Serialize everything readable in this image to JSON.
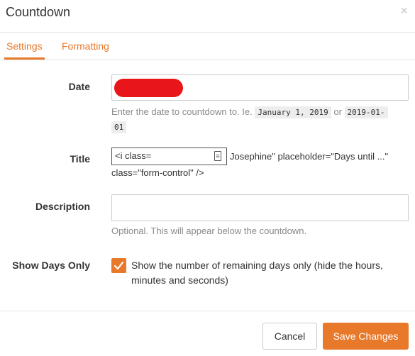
{
  "header": {
    "title": "Countdown",
    "close_label": "×"
  },
  "tabs": [
    {
      "label": "Settings",
      "active": true
    },
    {
      "label": "Formatting",
      "active": false
    }
  ],
  "form": {
    "date": {
      "label": "Date",
      "value": "",
      "help_prefix": "Enter the date to countdown to. Ie.",
      "example_1": "January 1, 2019",
      "help_or": "or",
      "example_2a": "2019-01-",
      "example_2b": "01"
    },
    "title": {
      "label": "Title",
      "input_value": "<i class=",
      "raw_after": "Josephine\" placeholder=\"Days until ...\"",
      "raw_line2": "class=\"form-control\" />"
    },
    "description": {
      "label": "Description",
      "value": "",
      "help": "Optional. This will appear below the countdown."
    },
    "show_days_only": {
      "label": "Show Days Only",
      "checked": true,
      "text": "Show the number of remaining days only (hide the hours, minutes and seconds)"
    }
  },
  "footer": {
    "cancel_label": "Cancel",
    "save_label": "Save Changes"
  },
  "colors": {
    "accent": "#e8782a",
    "redaction": "#e8161a"
  }
}
